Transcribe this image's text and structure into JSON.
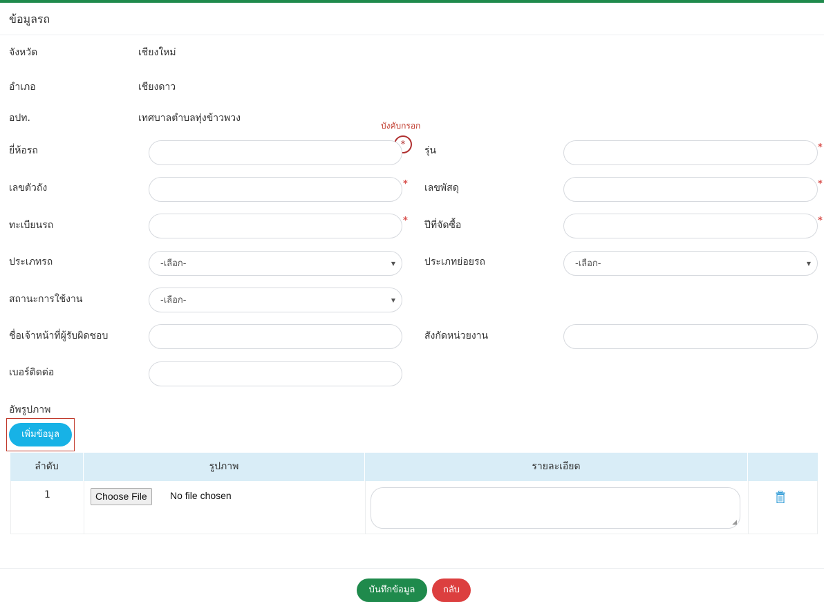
{
  "panel": {
    "title": "ข้อมูลรถ"
  },
  "info": [
    {
      "label": "จังหวัด",
      "value": "เชียงใหม่"
    },
    {
      "label": "อำเภอ",
      "value": "เชียงดาว"
    },
    {
      "label": "อปท.",
      "value": "เทศบาลตำบลทุ่งข้าวพวง"
    }
  ],
  "required_note": "บังคับกรอก",
  "required_mark": "*",
  "fields": {
    "brand": {
      "label": "ยี่ห้อรถ",
      "value": ""
    },
    "model": {
      "label": "รุ่น",
      "value": ""
    },
    "chassis": {
      "label": "เลขตัวถัง",
      "value": ""
    },
    "parcel": {
      "label": "เลขพัสดุ",
      "value": ""
    },
    "registration": {
      "label": "ทะเบียนรถ",
      "value": ""
    },
    "purchase_year": {
      "label": "ปีที่จัดซื้อ",
      "value": ""
    },
    "vehicle_type": {
      "label": "ประเภทรถ",
      "selected": "-เลือก-"
    },
    "vehicle_subtype": {
      "label": "ประเภทย่อยรถ",
      "selected": "-เลือก-"
    },
    "usage_status": {
      "label": "สถานะการใช้งาน",
      "selected": "-เลือก-"
    },
    "responsible_officer": {
      "label": "ชื่อเจ้าหน้าที่ผู้รับผิดชอบ",
      "value": ""
    },
    "affiliation": {
      "label": "สังกัดหน่วยงาน",
      "value": ""
    },
    "phone": {
      "label": "เบอร์ติดต่อ",
      "value": ""
    }
  },
  "upload": {
    "label": "อัพรูปภาพ",
    "add_button": "เพิ่มข้อมูล",
    "columns": [
      "ลำดับ",
      "รูปภาพ",
      "รายละเอียด"
    ],
    "rows": [
      {
        "index": "1",
        "file_button": "Choose File",
        "file_status": "No file chosen",
        "detail": ""
      }
    ]
  },
  "actions": {
    "save": "บันทึกข้อมูล",
    "back": "กลับ"
  },
  "colors": {
    "primary": "#1f8a4c",
    "info": "#17b2e6",
    "danger": "#dc3f3f",
    "table_header": "#d9edf7"
  }
}
